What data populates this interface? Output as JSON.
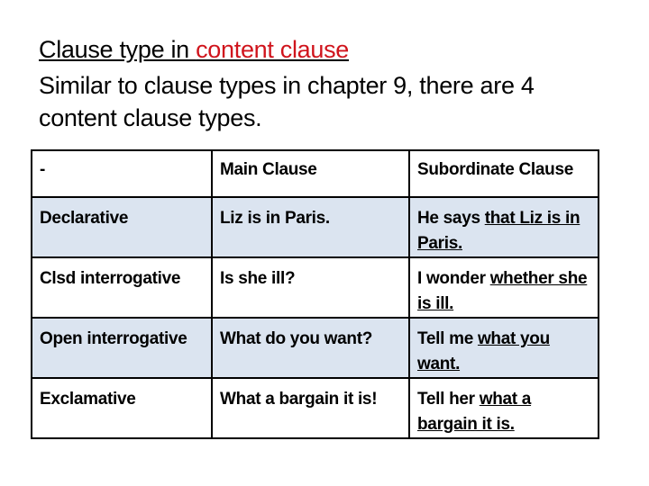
{
  "title": {
    "part1": "Clause type in ",
    "part2": "content clause",
    "accent_color": "#d0141c"
  },
  "subtitle": "Similar to clause types in chapter 9, there are 4 content clause types.",
  "table": {
    "headers": [
      "-",
      "Main Clause",
      "Subordinate Clause"
    ],
    "rows": [
      {
        "type": "Declarative",
        "main": "Liz is in Paris.",
        "sub_plain": "He says ",
        "sub_underlined": "that Liz is in Paris."
      },
      {
        "type": "Clsd interrogative",
        "main": "Is she ill?",
        "sub_plain": "I wonder ",
        "sub_underlined": "whether she is ill."
      },
      {
        "type": "Open interrogative",
        "main": "What do you want?",
        "sub_plain": "Tell me ",
        "sub_underlined": "what you want."
      },
      {
        "type": "Exclamative",
        "main": "What a bargain it is!",
        "sub_plain": "Tell her ",
        "sub_underlined": "what a bargain it is."
      }
    ],
    "shaded_row_color": "#dbe4f0"
  }
}
